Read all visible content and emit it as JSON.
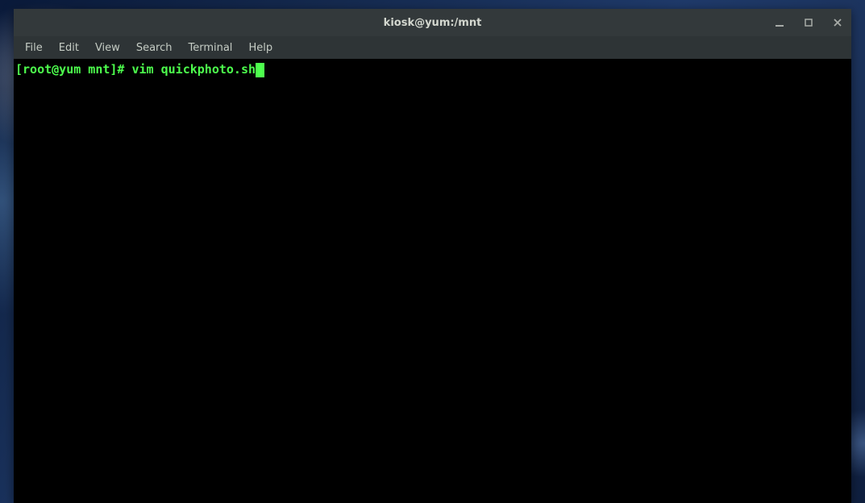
{
  "window": {
    "title": "kiosk@yum:/mnt"
  },
  "menubar": {
    "items": [
      "File",
      "Edit",
      "View",
      "Search",
      "Terminal",
      "Help"
    ]
  },
  "terminal": {
    "prompt": "[root@yum mnt]# ",
    "command": "vim quickphoto.sh"
  }
}
